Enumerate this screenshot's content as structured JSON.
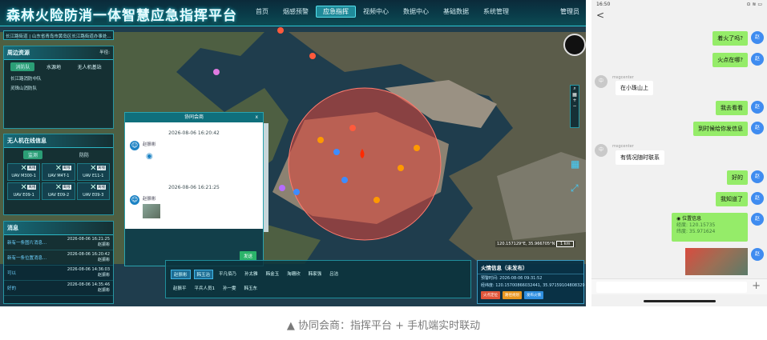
{
  "desktop": {
    "title": "森林火险防消一体智慧应急指挥平台",
    "nav": [
      "首页",
      "烟感预警",
      "应急指挥",
      "视频中心",
      "数据中心",
      "基础数据",
      "系统管理"
    ],
    "nav_active": 2,
    "admin": "管理员",
    "path": "长江路街道 | 山东省青岛市黄岛区长江路街道办事处...",
    "resources": {
      "title": "周边资源",
      "label": "半径:",
      "tabs": [
        "消防队",
        "水源地",
        "无人机基站"
      ],
      "items": [
        "长江路消防中队",
        "灵珠山消防队"
      ]
    },
    "uav": {
      "title": "无人机在线信息",
      "tabs": [
        "监测",
        "防防"
      ],
      "status": "离线",
      "items": [
        "UAV M300-1",
        "UAV M4T-1",
        "UAV E11-1",
        "UAV E09-1",
        "UAV E09-2",
        "UAV E09-3"
      ]
    },
    "messages": {
      "title": "消息",
      "items": [
        {
          "title": "新有一条图片消息...",
          "time": "2026-08-06 16:21:25",
          "user": "赵振彬"
        },
        {
          "title": "新有一条位置消息...",
          "time": "2026-08-06 16:20:42",
          "user": "赵振彬"
        },
        {
          "title": "可以",
          "time": "2026-08-06 14:36:03",
          "user": "赵振彬"
        },
        {
          "title": "好的",
          "time": "2026-08-06 14:35:46",
          "user": "赵振彬"
        }
      ]
    },
    "dialog": {
      "title": "协同会商",
      "close": "x",
      "msg1_time": "2026-08-06 16:20:42",
      "msg1_user": "赵振彬",
      "msg2_time": "2026-08-06 16:21:25",
      "msg2_user": "赵振彬",
      "send": "发送"
    },
    "people": {
      "row1": [
        "赵振彬",
        "韩玉治",
        "平凡佰乃",
        "孙太雅",
        "韩金玉",
        "淘珊欣",
        "韩家强",
        "吕洁"
      ],
      "row2": [
        "赵振平",
        "平兵人员1",
        "孙一雯",
        "韩玉东"
      ],
      "active": [
        0,
        1
      ]
    },
    "fire": {
      "title": "火情信息（未发布）",
      "time_label": "预警时间:",
      "time": "2026-08-06 09:31:52",
      "pos_label": "经纬度:",
      "pos": "120.15700866032441, 35.97159104808329",
      "btns": [
        "火点定位",
        "路径规划",
        "发布火情"
      ]
    },
    "coord": "120.157129°E, 35.966705°N",
    "scale": "1 km",
    "colors": {
      "accent": "#2bc6d5",
      "fire_zone": "#e0453a",
      "active_tab": "#1f8b9a"
    }
  },
  "phone": {
    "time": "16:50",
    "status_right": "⊙ ≋ ▭",
    "back": "<",
    "me": "赵",
    "other": "中",
    "other_name": "msgcenter",
    "chat": [
      {
        "from": "me",
        "text": "着火了吗?"
      },
      {
        "from": "me",
        "text": "火点在哪?"
      },
      {
        "from": "other",
        "text": "在小珠山上"
      },
      {
        "from": "me",
        "text": "我去看看"
      },
      {
        "from": "me",
        "text": "到时候给你发信息"
      },
      {
        "from": "other",
        "text": "有情况随时联系"
      },
      {
        "from": "me",
        "text": "好的"
      },
      {
        "from": "me",
        "text": "我知道了"
      }
    ],
    "location": {
      "title": "位置信息",
      "lon": "经度: 120.15735",
      "lat": "纬度: 35.971624"
    },
    "plus": "+"
  },
  "caption": "▲ 协同会商：指挥平台 + 手机端实时联动"
}
